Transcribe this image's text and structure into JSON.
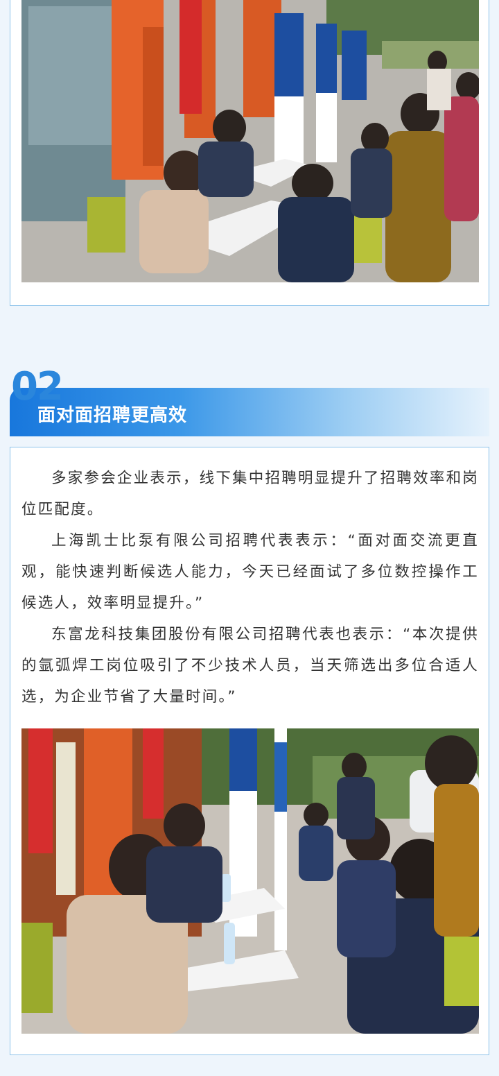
{
  "section": {
    "number": "02",
    "title": "面对面招聘更高效"
  },
  "paragraphs": [
    "多家参会企业表示，线下集中招聘明显提升了招聘效率和岗位匹配度。",
    "上海凯士比泵有限公司招聘代表表示：“面对面交流更直观，能快速判断候选人能力，今天已经面试了多位数控操作工候选人，效率明显提升。”",
    "东富龙科技集团股份有限公司招聘代表也表示：“本次提供的氩弧焊工岗位吸引了不少技术人员，当天筛选出多位合适人选，为企业节省了大量时间。”"
  ],
  "colors": {
    "accent": "#2a86dc",
    "border": "#8ec3ea",
    "page_bg": "#eef5fc",
    "text": "#333333"
  }
}
